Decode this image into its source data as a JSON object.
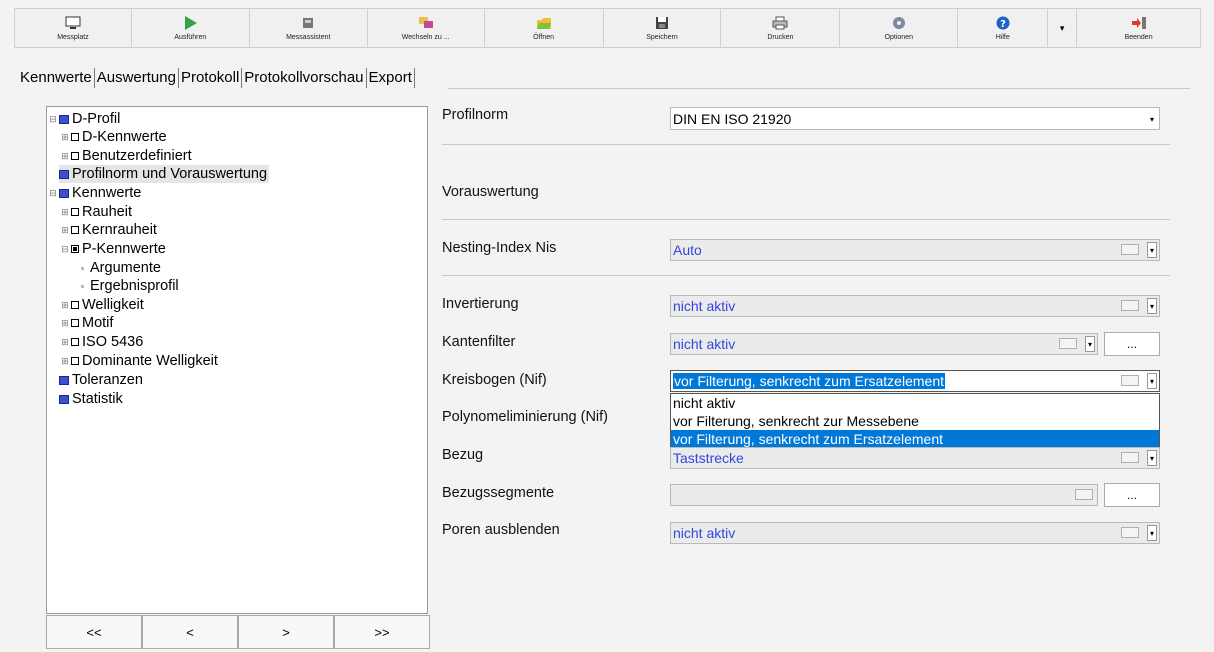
{
  "toolbar": {
    "buttons": [
      {
        "label": "Messplatz",
        "icon": "monitor-icon"
      },
      {
        "label": "Ausführen",
        "icon": "play-icon"
      },
      {
        "label": "Messassistent",
        "icon": "wizard-icon"
      },
      {
        "label": "Wechseln zu ...",
        "icon": "switch-icon"
      },
      {
        "label": "Öffnen",
        "icon": "folder-open-icon"
      },
      {
        "label": "Speichern",
        "icon": "save-icon"
      },
      {
        "label": "Drucken",
        "icon": "printer-icon"
      },
      {
        "label": "Optionen",
        "icon": "gear-icon"
      },
      {
        "label": "Hilfe",
        "icon": "help-icon"
      },
      {
        "label": "Beenden",
        "icon": "exit-icon"
      }
    ]
  },
  "tabs": [
    "Kennwerte",
    "Auswertung",
    "Protokoll",
    "Protokollvorschau",
    "Export"
  ],
  "tree": [
    {
      "label": "D-Profil"
    },
    {
      "label": "D-Kennwerte"
    },
    {
      "label": "Benutzerdefiniert"
    },
    {
      "label": "Profilnorm und Vorauswertung"
    },
    {
      "label": "Kennwerte"
    },
    {
      "label": "Rauheit"
    },
    {
      "label": "Kernrauheit"
    },
    {
      "label": "P-Kennwerte"
    },
    {
      "label": "Argumente"
    },
    {
      "label": "Ergebnisprofil"
    },
    {
      "label": "Welligkeit"
    },
    {
      "label": "Motif"
    },
    {
      "label": "ISO 5436"
    },
    {
      "label": "Dominante Welligkeit"
    },
    {
      "label": "Toleranzen"
    },
    {
      "label": "Statistik"
    }
  ],
  "nav": [
    "<<",
    "<",
    ">",
    ">>"
  ],
  "form": {
    "profilnorm_label": "Profilnorm",
    "profilnorm_value": "DIN EN ISO 21920",
    "vorauswertung_label": "Vorauswertung",
    "nesting_label": "Nesting-Index Nis",
    "nesting_value": "Auto",
    "invertierung_label": "Invertierung",
    "invertierung_value": "nicht aktiv",
    "kantenfilter_label": "Kantenfilter",
    "kantenfilter_value": "nicht aktiv",
    "kreisbogen_label": "Kreisbogen (Nif)",
    "kreisbogen_value": "vor Filterung, senkrecht zum Ersatzelement",
    "polynom_label": "Polynomeliminierung (Nif)",
    "bezug_label": "Bezug",
    "bezug_value": "Taststrecke",
    "bezugssegmente_label": "Bezugssegmente",
    "bezugssegmente_value": "",
    "poren_label": "Poren ausblenden",
    "poren_value": "nicht aktiv",
    "dots_label": "...",
    "dropdown_options": [
      "nicht aktiv",
      "vor Filterung, senkrecht zur Messebene",
      "vor Filterung, senkrecht zum Ersatzelement"
    ]
  }
}
